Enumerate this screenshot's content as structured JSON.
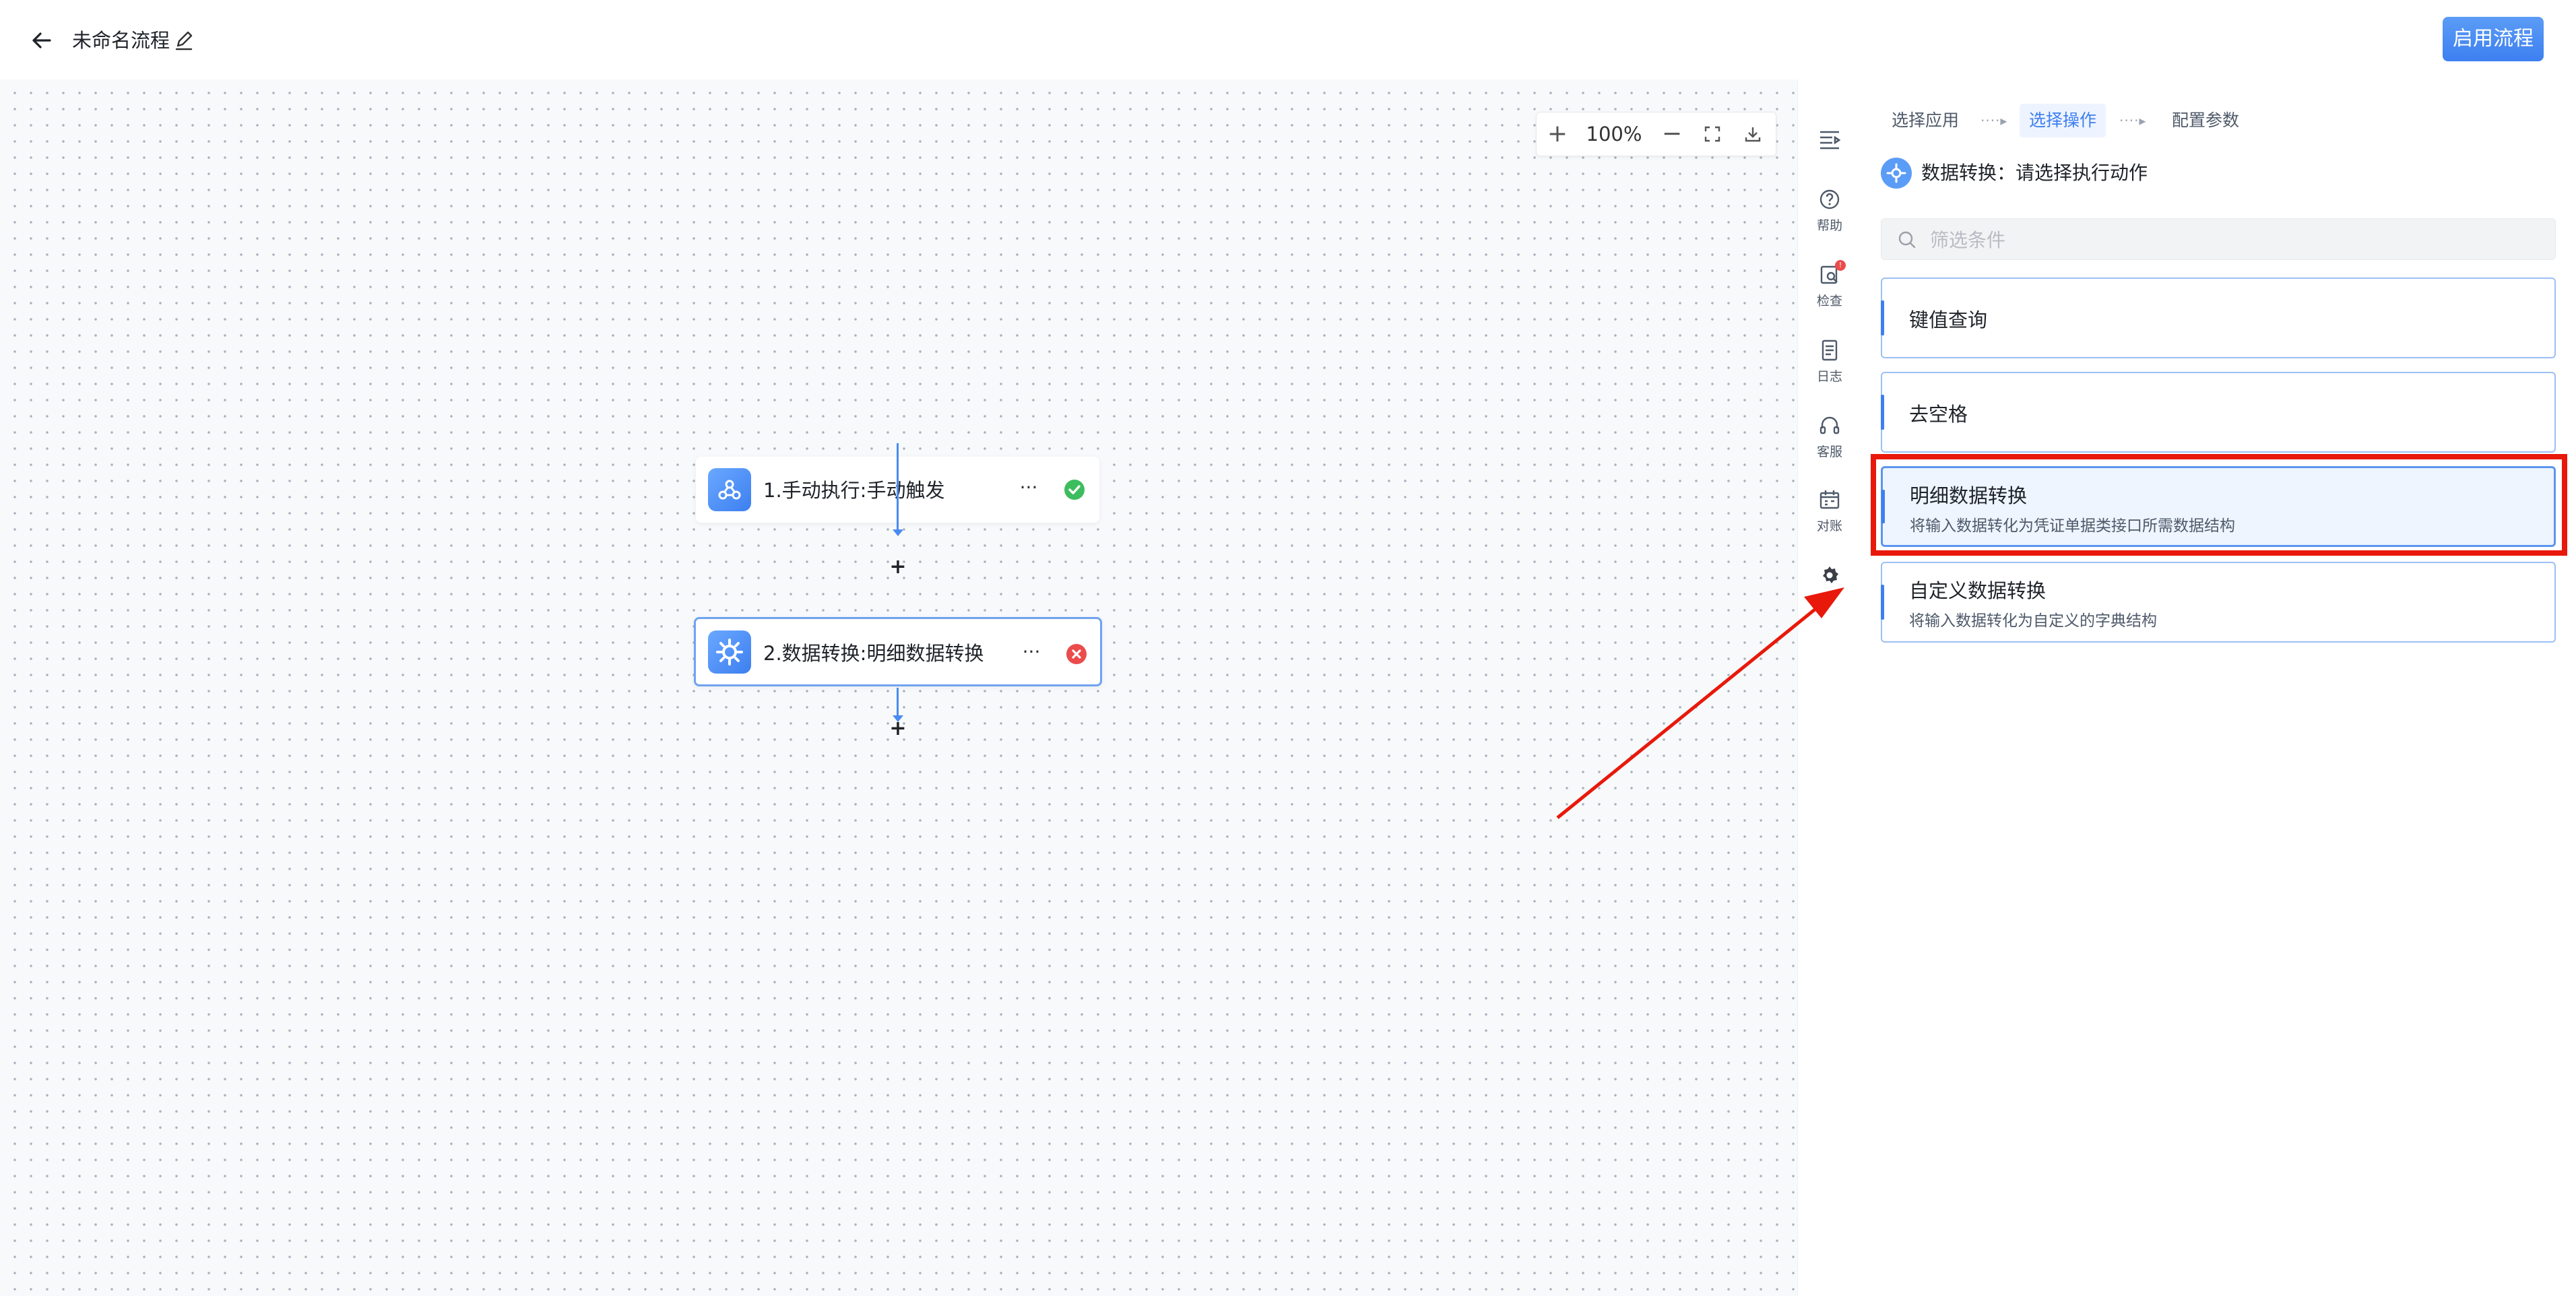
{
  "header": {
    "title": "未命名流程",
    "enable_button": "启用流程"
  },
  "canvas": {
    "zoom": "100%",
    "nodes": [
      {
        "label": "1.手动执行:手动触发",
        "status": "success"
      },
      {
        "label": "2.数据转换:明细数据转换",
        "status": "error"
      }
    ]
  },
  "toolbar": {
    "items": [
      {
        "icon": "list-collapse-icon",
        "label": ""
      },
      {
        "icon": "help-icon",
        "label": "帮助"
      },
      {
        "icon": "check-icon",
        "label": "检查",
        "badge": "!"
      },
      {
        "icon": "log-icon",
        "label": "日志"
      },
      {
        "icon": "headset-icon",
        "label": "客服"
      },
      {
        "icon": "calendar-icon",
        "label": "对账"
      },
      {
        "icon": "gear-icon",
        "label": ""
      }
    ]
  },
  "panel": {
    "steps": [
      "选择应用",
      "选择操作",
      "配置参数"
    ],
    "active_step": 1,
    "heading": "数据转换：请选择执行动作",
    "search_placeholder": "筛选条件",
    "actions": [
      {
        "title": "键值查询",
        "desc": ""
      },
      {
        "title": "去空格",
        "desc": ""
      },
      {
        "title": "明细数据转换",
        "desc": "将输入数据转化为凭证单据类接口所需数据结构",
        "selected": true
      },
      {
        "title": "自定义数据转换",
        "desc": "将输入数据转化为自定义的字典结构"
      }
    ]
  },
  "colors": {
    "accent": "#3d7ff0",
    "annotation": "#e8190b",
    "success": "#3dbd5d",
    "error": "#ec4b4b"
  }
}
